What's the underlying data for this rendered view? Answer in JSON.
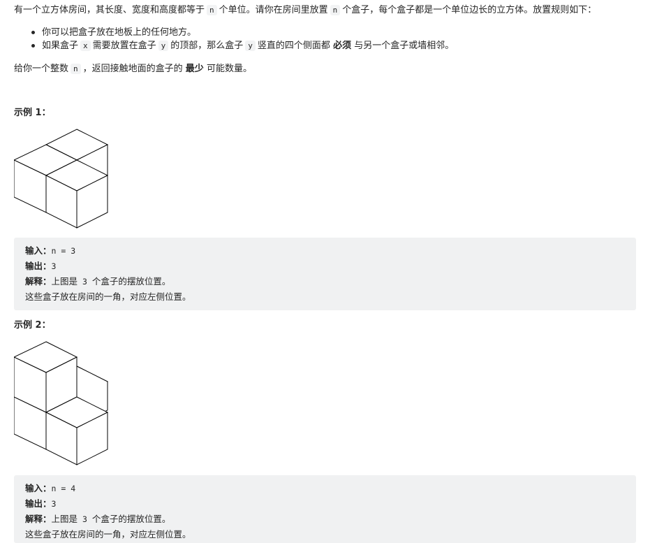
{
  "intro": {
    "p1_a": "有一个立方体房间，其长度、宽度和高度都等于",
    "p1_n1": "n",
    "p1_b": "个单位。请你在房间里放置",
    "p1_n2": "n",
    "p1_c": "个盒子，每个盒子都是一个单位边长的立方体。放置规则如下："
  },
  "rules": {
    "r1": "你可以把盒子放在地板上的任何地方。",
    "r2_a": "如果盒子",
    "r2_x": "x",
    "r2_b": "需要放置在盒子",
    "r2_y1": "y",
    "r2_c": "的顶部，那么盒子",
    "r2_y2": "y",
    "r2_d": "竖直的四个侧面都",
    "r2_bold": "必须",
    "r2_e": "与另一个盒子或墙相邻。"
  },
  "given": {
    "a": "给你一个整数",
    "n": "n",
    "b": "，返回接触地面的盒子的",
    "bold": "最少",
    "c": "可能数量。"
  },
  "example1": {
    "title": "示例 1：",
    "input_label": "输入：",
    "input_value": "n = 3",
    "output_label": "输出：",
    "output_value": "3",
    "explain_label": "解释：",
    "explain_a": "上图是",
    "explain_num": "3",
    "explain_b": "个盒子的摆放位置。",
    "line4": "这些盒子放在房间的一角，对应左侧位置。"
  },
  "example2": {
    "title": "示例 2：",
    "input_label": "输入：",
    "input_value": "n = 4",
    "output_label": "输出：",
    "output_value": "3",
    "explain_label": "解释：",
    "explain_a": "上图是",
    "explain_num": "3",
    "explain_b": "个盒子的摆放位置。",
    "line4": "这些盒子放在房间的一角，对应左侧位置。"
  }
}
